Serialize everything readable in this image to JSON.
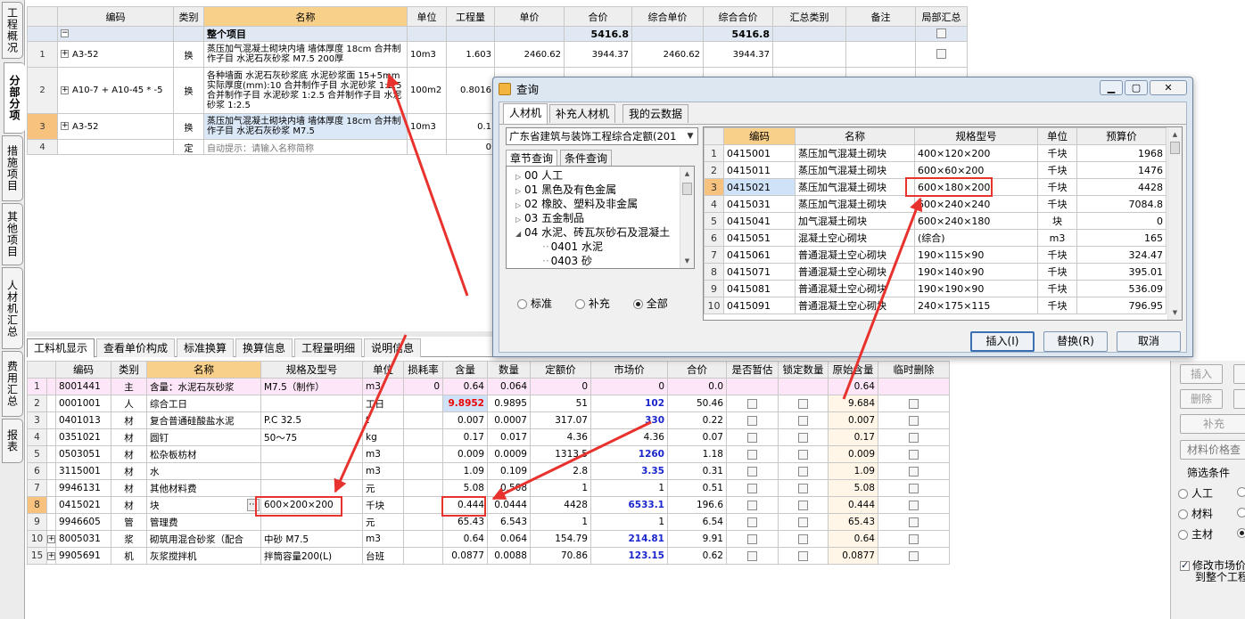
{
  "left_tabs": [
    "工程概况",
    "分部分项",
    "措施项目",
    "其他项目",
    "人材机汇总",
    "费用汇总",
    "报表"
  ],
  "top_grid": {
    "headers": [
      "",
      "编码",
      "类别",
      "名称",
      "单位",
      "工程量",
      "单价",
      "合价",
      "综合单价",
      "综合合价",
      "汇总类别",
      "备注",
      "局部汇总"
    ],
    "project_row": {
      "expander": "−",
      "name": "整个项目",
      "total": "5416.8",
      "total2": "5416.8"
    },
    "rows": [
      {
        "no": "1",
        "expander": "+",
        "code": "A3-52",
        "type": "换",
        "name": "蒸压加气混凝土砌块内墙 墙体厚度 18cm 合并制作子目 水泥石灰砂浆 M7.5 200厚",
        "unit": "10m3",
        "qty": "1.603",
        "price": "2460.62",
        "total": "3944.37",
        "cprice": "2460.62",
        "ctotal": "3944.37"
      },
      {
        "no": "2",
        "expander": "+",
        "code": "A10-7 + A10-45 * -5",
        "type": "换",
        "name": "各种墙面 水泥石灰砂浆底 水泥砂浆面 15+5mm 实际厚度(mm):10 合并制作子目 水泥砂浆 1:2.5 合并制作子目 水泥砂浆 1:2.5 合并制作子目 水泥砂浆 1:2.5",
        "unit": "100m2",
        "qty": "0.8016",
        "price": "",
        "total": "",
        "cprice": "",
        "ctotal": ""
      },
      {
        "no": "3",
        "expander": "+",
        "code": "A3-52",
        "type": "换",
        "name": "蒸压加气混凝土砌块内墙 墙体厚度 18cm 合并制作子目 水泥石灰砂浆 M7.5",
        "unit": "10m3",
        "qty": "0.1",
        "price": "",
        "total": "",
        "cprice": "",
        "ctotal": ""
      },
      {
        "no": "4",
        "expander": "",
        "code": "",
        "type": "定",
        "name": "自动提示：请输入名称简称",
        "unit": "",
        "qty": "0",
        "price": "",
        "total": "",
        "cprice": "",
        "ctotal": ""
      }
    ]
  },
  "bottom_tabs": [
    "工料机显示",
    "查看单价构成",
    "标准换算",
    "换算信息",
    "工程量明细",
    "说明信息"
  ],
  "bottom_grid": {
    "headers": [
      "",
      "编码",
      "类别",
      "名称",
      "规格及型号",
      "单位",
      "损耗率",
      "含量",
      "数量",
      "定额价",
      "市场价",
      "合价",
      "是否暂估",
      "锁定数量",
      "原始含量",
      "临时删除"
    ],
    "rows": [
      {
        "no": "1",
        "exp": "",
        "code": "8001441",
        "type": "主",
        "name": "含量：水泥石灰砂浆",
        "spec": "M7.5（制作）",
        "unit": "m3",
        "loss": "0",
        "content": "0.64",
        "qty": "0.064",
        "dprice": "0",
        "mprice": "0",
        "total": "0.0",
        "orig": "0.64"
      },
      {
        "no": "2",
        "exp": "",
        "code": "0001001",
        "type": "人",
        "name": "综合工日",
        "spec": "",
        "unit": "工日",
        "loss": "",
        "content": "9.8952",
        "qty": "0.9895",
        "dprice": "51",
        "mprice": "102",
        "total": "50.46",
        "orig": "9.684"
      },
      {
        "no": "3",
        "exp": "",
        "code": "0401013",
        "type": "材",
        "name": "复合普通硅酸盐水泥",
        "spec": "P.C  32.5",
        "unit": "t",
        "loss": "",
        "content": "0.007",
        "qty": "0.0007",
        "dprice": "317.07",
        "mprice": "330",
        "total": "0.22",
        "orig": "0.007"
      },
      {
        "no": "4",
        "exp": "",
        "code": "0351021",
        "type": "材",
        "name": "圆钉",
        "spec": "50～75",
        "unit": "kg",
        "loss": "",
        "content": "0.17",
        "qty": "0.017",
        "dprice": "4.36",
        "mprice": "4.36",
        "total": "0.07",
        "orig": "0.17"
      },
      {
        "no": "5",
        "exp": "",
        "code": "0503051",
        "type": "材",
        "name": "松杂板枋材",
        "spec": "",
        "unit": "m3",
        "loss": "",
        "content": "0.009",
        "qty": "0.0009",
        "dprice": "1313.5",
        "mprice": "1260",
        "total": "1.18",
        "orig": "0.009"
      },
      {
        "no": "6",
        "exp": "",
        "code": "3115001",
        "type": "材",
        "name": "水",
        "spec": "",
        "unit": "m3",
        "loss": "",
        "content": "1.09",
        "qty": "0.109",
        "dprice": "2.8",
        "mprice": "3.35",
        "total": "0.31",
        "orig": "1.09"
      },
      {
        "no": "7",
        "exp": "",
        "code": "9946131",
        "type": "材",
        "name": "其他材料费",
        "spec": "",
        "unit": "元",
        "loss": "",
        "content": "5.08",
        "qty": "0.508",
        "dprice": "1",
        "mprice": "1",
        "total": "0.51",
        "orig": "5.08"
      },
      {
        "no": "8",
        "exp": "",
        "code": "0415021",
        "type": "材",
        "name": "块",
        "spec": "600×200×200",
        "unit": "千块",
        "loss": "",
        "content": "0.444",
        "qty": "0.0444",
        "dprice": "4428",
        "mprice": "6533.1",
        "total": "196.6",
        "orig": "0.444"
      },
      {
        "no": "9",
        "exp": "",
        "code": "9946605",
        "type": "管",
        "name": "管理费",
        "spec": "",
        "unit": "元",
        "loss": "",
        "content": "65.43",
        "qty": "6.543",
        "dprice": "1",
        "mprice": "1",
        "total": "6.54",
        "orig": "65.43"
      },
      {
        "no": "10",
        "exp": "+",
        "code": "8005031",
        "type": "浆",
        "name": "砌筑用混合砂浆（配合",
        "spec": "中砂 M7.5",
        "unit": "m3",
        "loss": "",
        "content": "0.64",
        "qty": "0.064",
        "dprice": "154.79",
        "mprice": "214.81",
        "total": "9.91",
        "orig": "0.64"
      },
      {
        "no": "15",
        "exp": "+",
        "code": "9905691",
        "type": "机",
        "name": "灰浆搅拌机",
        "spec": "拌筒容量200(L)",
        "unit": "台班",
        "loss": "",
        "content": "0.0877",
        "qty": "0.0088",
        "dprice": "70.86",
        "mprice": "123.15",
        "total": "0.62",
        "orig": "0.0877"
      }
    ]
  },
  "right_panel": {
    "insert": "插入",
    "delete": "删除",
    "supplement": "补充",
    "material_price": "材料价格查",
    "filter_label": "筛选条件",
    "filters": [
      "人工",
      "材料",
      "主材"
    ],
    "modify_label_1": "修改市场价",
    "modify_label_2": "到整个工程"
  },
  "dialog": {
    "title": "查询",
    "tabs": [
      "人材机",
      "补充人材机",
      "我的云数据"
    ],
    "select_value": "广东省建筑与装饰工程综合定额(201",
    "subtabs": [
      "章节查询",
      "条件查询"
    ],
    "tree": [
      {
        "label": "00 人工",
        "arrow": "▷",
        "indent": 1
      },
      {
        "label": "01 黑色及有色金属",
        "arrow": "▷",
        "indent": 1
      },
      {
        "label": "02 橡胶、塑料及非金属",
        "arrow": "▷",
        "indent": 1
      },
      {
        "label": "03 五金制品",
        "arrow": "▷",
        "indent": 1
      },
      {
        "label": "04 水泥、砖瓦灰砂石及混凝土",
        "arrow": "◢",
        "indent": 1
      },
      {
        "label": "0401 水泥",
        "arrow": "",
        "indent": 2
      },
      {
        "label": "0403 砂",
        "arrow": "",
        "indent": 2
      }
    ],
    "radios": [
      "标准",
      "补充",
      "全部"
    ],
    "grid_headers": [
      "",
      "编码",
      "名称",
      "规格型号",
      "单位",
      "预算价"
    ],
    "grid_rows": [
      {
        "no": "1",
        "code": "0415001",
        "name": "蒸压加气混凝土砌块",
        "spec": "400×120×200",
        "unit": "千块",
        "price": "1968"
      },
      {
        "no": "2",
        "code": "0415011",
        "name": "蒸压加气混凝土砌块",
        "spec": "600×60×200",
        "unit": "千块",
        "price": "1476"
      },
      {
        "no": "3",
        "code": "0415021",
        "name": "蒸压加气混凝土砌块",
        "spec": "600×180×200",
        "unit": "千块",
        "price": "4428"
      },
      {
        "no": "4",
        "code": "0415031",
        "name": "蒸压加气混凝土砌块",
        "spec": "600×240×240",
        "unit": "千块",
        "price": "7084.8"
      },
      {
        "no": "5",
        "code": "0415041",
        "name": "加气混凝土砌块",
        "spec": "600×240×180",
        "unit": "块",
        "price": "0"
      },
      {
        "no": "6",
        "code": "0415051",
        "name": "混凝土空心砌块",
        "spec": "(综合)",
        "unit": "m3",
        "price": "165"
      },
      {
        "no": "7",
        "code": "0415061",
        "name": "普通混凝土空心砌块",
        "spec": "190×115×90",
        "unit": "千块",
        "price": "324.47"
      },
      {
        "no": "8",
        "code": "0415071",
        "name": "普通混凝土空心砌块",
        "spec": "190×140×90",
        "unit": "千块",
        "price": "395.01"
      },
      {
        "no": "9",
        "code": "0415081",
        "name": "普通混凝土空心砌块",
        "spec": "190×190×90",
        "unit": "千块",
        "price": "536.09"
      },
      {
        "no": "10",
        "code": "0415091",
        "name": "普通混凝土空心砌块",
        "spec": "240×175×115",
        "unit": "千块",
        "price": "796.95"
      }
    ],
    "buttons": {
      "insert": "插入(I)",
      "replace": "替换(R)",
      "cancel": "取消"
    }
  }
}
